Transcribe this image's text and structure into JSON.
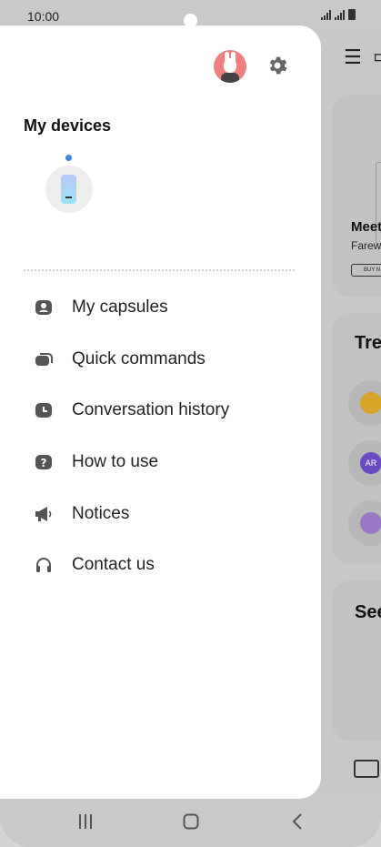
{
  "status_bar": {
    "time": "10:00"
  },
  "drawer": {
    "section_title": "My devices",
    "menu": [
      {
        "label": "My capsules",
        "icon": "capsule-icon"
      },
      {
        "label": "Quick commands",
        "icon": "quick-command-icon"
      },
      {
        "label": "Conversation history",
        "icon": "history-icon"
      },
      {
        "label": "How to use",
        "icon": "help-icon"
      },
      {
        "label": "Notices",
        "icon": "megaphone-icon"
      },
      {
        "label": "Contact us",
        "icon": "headset-icon"
      }
    ]
  },
  "background_app": {
    "card1_title": "Meet",
    "card1_subtitle": "Farew",
    "card1_button": "BUY N",
    "card2_title": "Tre",
    "card3_title": "See",
    "ar_badge": "AR"
  },
  "colors": {
    "accent_dot": "#3d83e8",
    "avatar_bg": "#f08080",
    "drawer_bg": "#ffffff",
    "scrim": "#c9c9c9"
  }
}
